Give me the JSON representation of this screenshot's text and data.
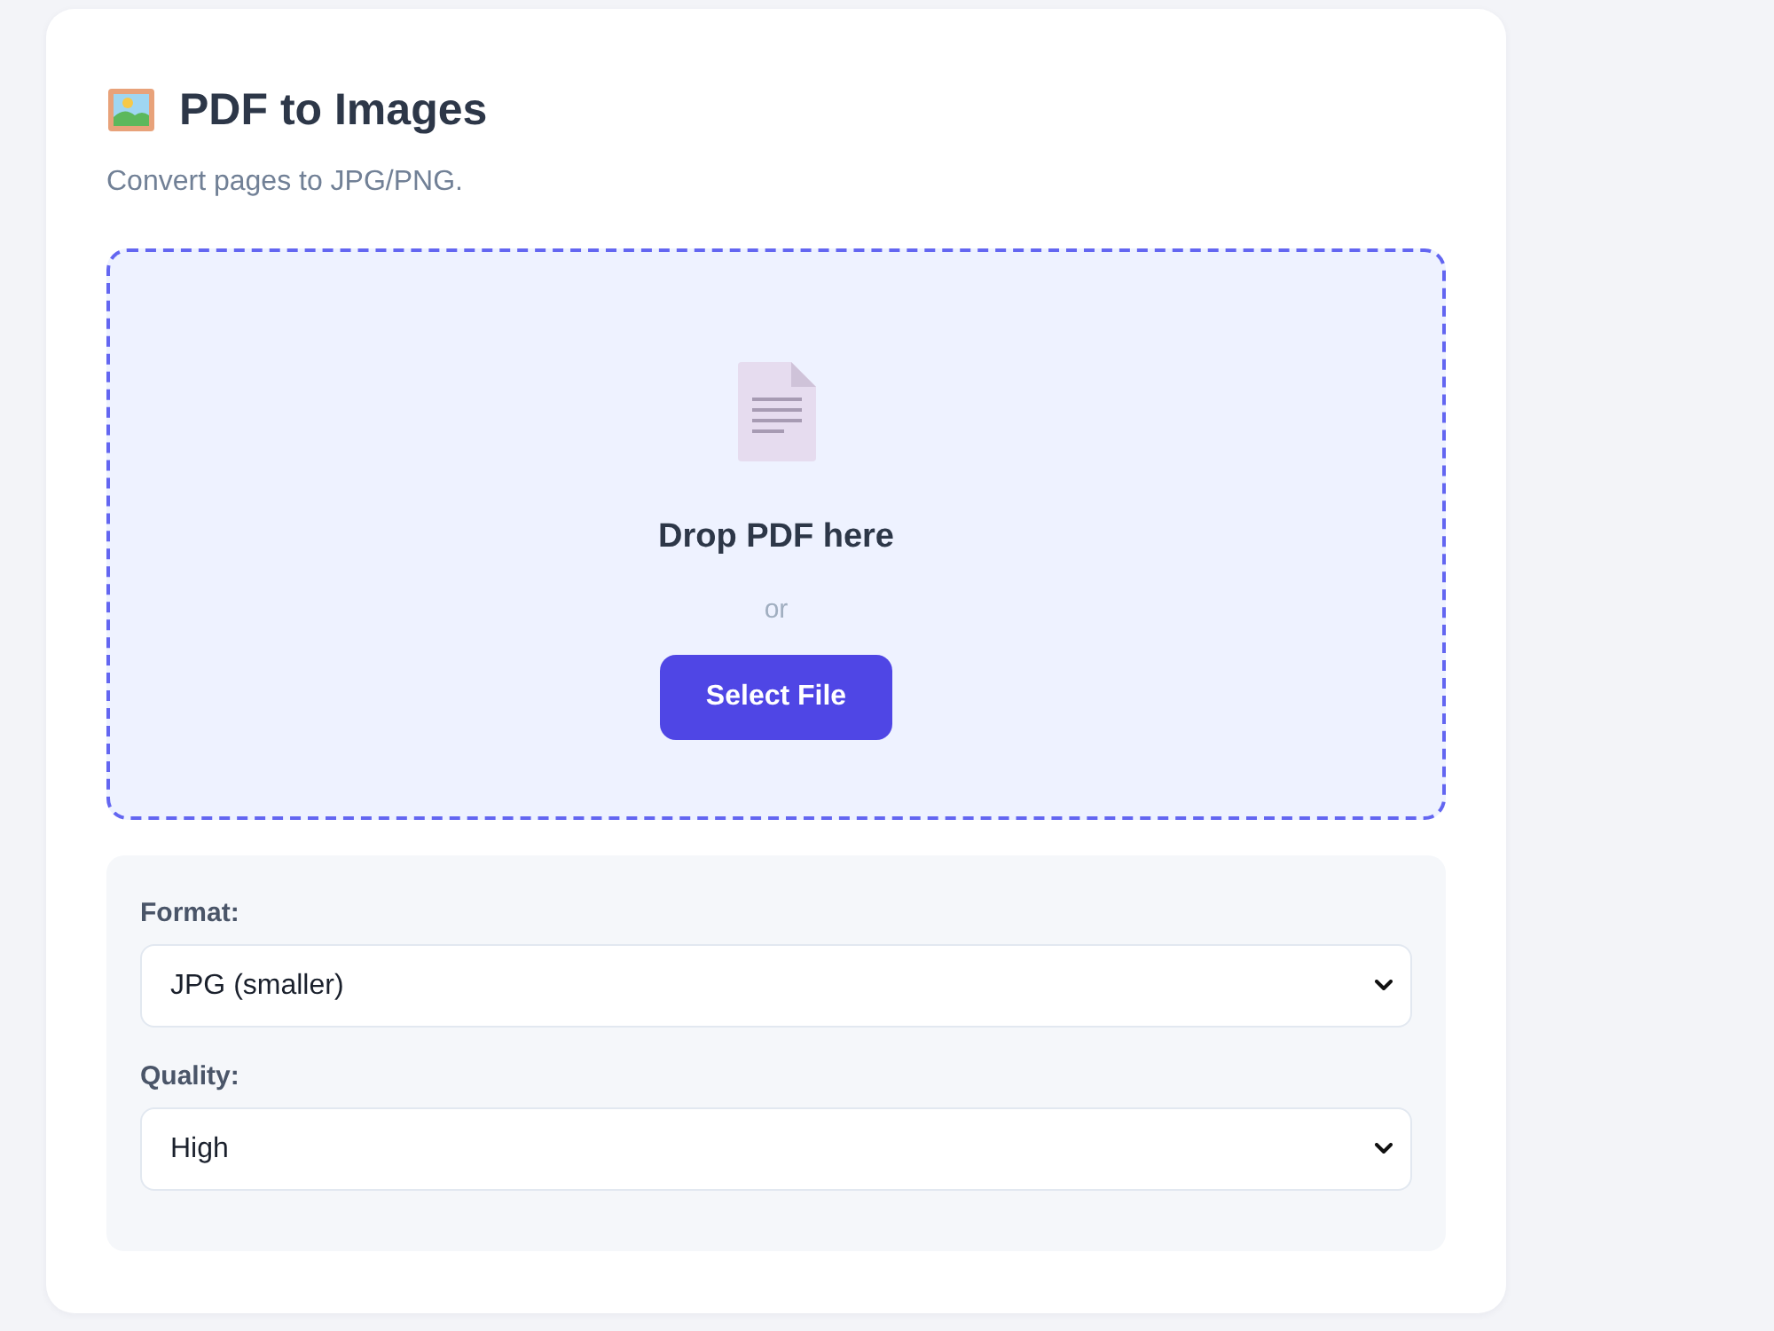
{
  "header": {
    "title": "PDF to Images",
    "subtitle": "Convert pages to JPG/PNG."
  },
  "dropzone": {
    "heading": "Drop PDF here",
    "separator": "or",
    "button": "Select File"
  },
  "options": [
    {
      "label": "Format:",
      "value": "JPG (smaller)"
    },
    {
      "label": "Quality:",
      "value": "High"
    }
  ]
}
